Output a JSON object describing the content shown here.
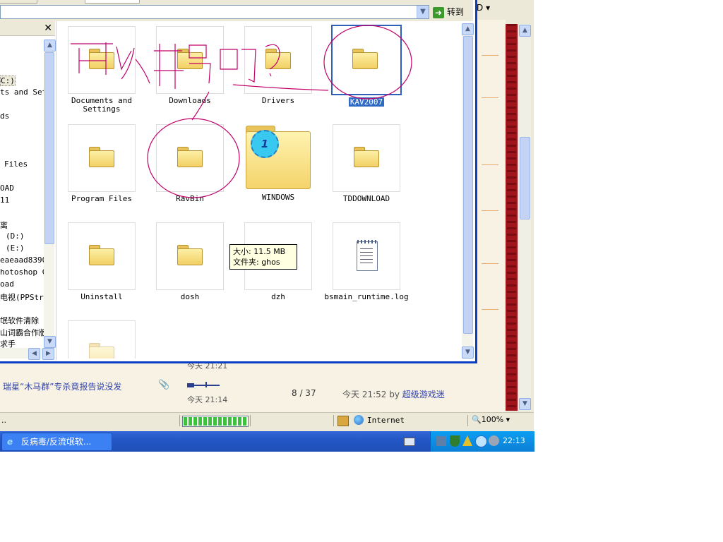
{
  "browser": {
    "top_right_label": "D",
    "rows": [
      {
        "title": "瑞星“木马群”专杀竟报告说没发",
        "date": "今天  21:14",
        "replies": "8 / 37",
        "last_post_prefix": "今天  21:52 by",
        "last_post_user": "超级游戏迷"
      }
    ],
    "prev_row_date": "今天  21:21",
    "status": {
      "left_text": "..",
      "zone": "Internet",
      "zoom": "100%",
      "progress": 1.0
    }
  },
  "taskbar": {
    "task_label": "反病毒/反流氓软...",
    "clock": "22:13"
  },
  "explorer": {
    "go_label": "转到",
    "tree_items": [
      "C:)",
      "ts and Set",
      "ds",
      "Files",
      "OAD",
      "11",
      "离",
      "(D:)",
      "(E:)",
      "eaeaad8390",
      "hotoshop C",
      "oad",
      "电视(PPStr",
      "氓软件清除",
      "山词霸合作版",
      "求手"
    ],
    "items": [
      {
        "label": "Documents and Settings"
      },
      {
        "label": "Downloads"
      },
      {
        "label": "Drivers"
      },
      {
        "label": "KAV2007"
      },
      {
        "label": "Program Files"
      },
      {
        "label": "RavBin"
      },
      {
        "label": "WINDOWS"
      },
      {
        "label": "TDDOWNLOAD"
      },
      {
        "label": "Uninstall"
      },
      {
        "label": "dosh"
      },
      {
        "label": "dzh"
      },
      {
        "label": "bsmain_runtime.log"
      }
    ],
    "tooltip": {
      "size_line": "大小: 11.5 MB",
      "folder_line": "文件夹: ghos"
    }
  },
  "colors": {
    "selection": "#316ac5",
    "window_border": "#0a3fc4",
    "annotation": "#c0006a",
    "taskbar": "#2557c7"
  },
  "icons": [
    "folder-icon",
    "document-icon",
    "go-arrow-icon",
    "internet-globe-icon",
    "zoom-icon",
    "attachment-icon",
    "ie-icon"
  ]
}
